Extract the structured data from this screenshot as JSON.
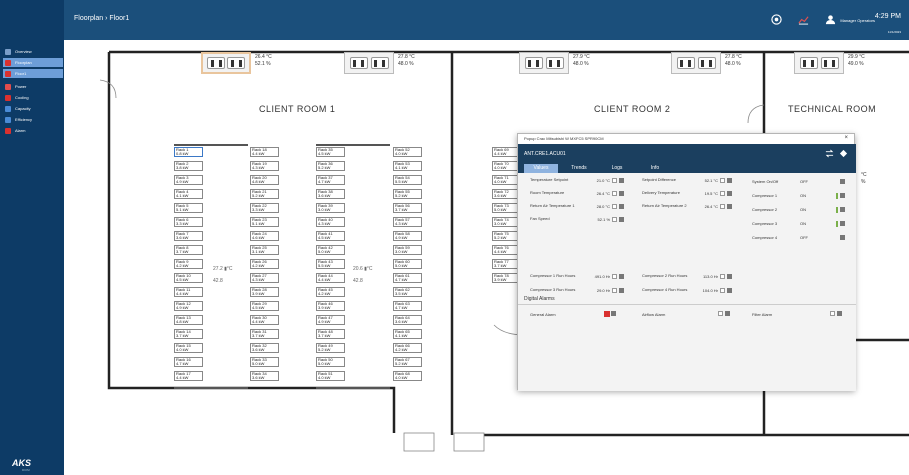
{
  "header": {
    "breadcrumb": "Floorplan  ›  Floor1",
    "time": "4:29 PM",
    "date": "11/1/2023",
    "user": "Manager Operators"
  },
  "nav": [
    {
      "label": "Overview",
      "color": "#7a9ec9"
    },
    {
      "label": "Floorplan",
      "color": "#d9312f"
    },
    {
      "label": "Floor1",
      "color": "#d9312f"
    },
    {
      "label": "Power",
      "color": "#e04d4d"
    },
    {
      "label": "Cooling",
      "color": "#d9312f"
    },
    {
      "label": "Capacity",
      "color": "#4a8bd6"
    },
    {
      "label": "Efficiency",
      "color": "#4a8bd6"
    },
    {
      "label": "Alarm",
      "color": "#d9312f"
    }
  ],
  "brand": {
    "name": "AKS",
    "sub": "DCIM"
  },
  "rooms": {
    "r1": "CLIENT ROOM 1",
    "r2": "CLIENT ROOM 2",
    "tech": "TECHNICAL ROOM"
  },
  "acus": [
    {
      "temp": "26.4 °C",
      "hum": "52.1 %"
    },
    {
      "temp": "27.8 °C",
      "hum": "48.0 %"
    },
    {
      "temp": "27.9 °C",
      "hum": "48.0 %"
    },
    {
      "temp": "27.8 °C",
      "hum": "48.0 %"
    },
    {
      "temp": "29.9 °C",
      "hum": "49.0 %"
    }
  ],
  "room_mid": [
    {
      "temp": "27.2",
      "unit": "°C",
      "pow": "42.8"
    },
    {
      "temp": "20.6",
      "unit": "°C",
      "pow": "42.8"
    }
  ],
  "col1": [
    [
      "Rack 1",
      "0.8 kW"
    ],
    [
      "Rack 2",
      "3.8 kW"
    ],
    [
      "Rack 3",
      "4.9 kW"
    ],
    [
      "Rack 4",
      "4.1 kW"
    ],
    [
      "Rack 5",
      "5.1 kW"
    ],
    [
      "Rack 6",
      "3.3 kW"
    ],
    [
      "Rack 7",
      "3.6 kW"
    ],
    [
      "Rack 8",
      "3.7 kW"
    ],
    [
      "Rack 9",
      "4.2 kW"
    ],
    [
      "Rack 10",
      "4.5 kW"
    ],
    [
      "Rack 11",
      "4.4 kW"
    ],
    [
      "Rack 12",
      "4.9 kW"
    ],
    [
      "Rack 13",
      "4.8 kW"
    ],
    [
      "Rack 14",
      "3.7 kW"
    ],
    [
      "Rack 15",
      "4.0 kW"
    ],
    [
      "Rack 16",
      "4.7 kW"
    ],
    [
      "Rack 17",
      "4.4 kW"
    ]
  ],
  "col2": [
    [
      "Rack 18",
      "4.4 kW"
    ],
    [
      "Rack 19",
      "4.3 kW"
    ],
    [
      "Rack 20",
      "4.8 kW"
    ],
    [
      "Rack 21",
      "5.2 kW"
    ],
    [
      "Rack 22",
      "3.3 kW"
    ],
    [
      "Rack 23",
      "5.1 kW"
    ],
    [
      "Rack 24",
      "4.6 kW"
    ],
    [
      "Rack 25",
      "3.1 kW"
    ],
    [
      "Rack 26",
      "4.2 kW"
    ],
    [
      "Rack 27",
      "4.3 kW"
    ],
    [
      "Rack 28",
      "3.9 kW"
    ],
    [
      "Rack 29",
      "4.5 kW"
    ],
    [
      "Rack 30",
      "4.4 kW"
    ],
    [
      "Rack 31",
      "3.7 kW"
    ],
    [
      "Rack 32",
      "3.6 kW"
    ],
    [
      "Rack 33",
      "5.0 kW"
    ],
    [
      "Rack 34",
      "3.6 kW"
    ]
  ],
  "col3": [
    [
      "Rack 35",
      "4.5 kW"
    ],
    [
      "Rack 36",
      "5.2 kW"
    ],
    [
      "Rack 37",
      "4.7 kW"
    ],
    [
      "Rack 38",
      "3.6 kW"
    ],
    [
      "Rack 39",
      "3.0 kW"
    ],
    [
      "Rack 40",
      "4.3 kW"
    ],
    [
      "Rack 41",
      "4.5 kW"
    ],
    [
      "Rack 42",
      "5.0 kW"
    ],
    [
      "Rack 43",
      "5.5 kW"
    ],
    [
      "Rack 44",
      "4.4 kW"
    ],
    [
      "Rack 45",
      "4.2 kW"
    ],
    [
      "Rack 46",
      "3.9 kW"
    ],
    [
      "Rack 47",
      "4.9 kW"
    ],
    [
      "Rack 48",
      "3.7 kW"
    ],
    [
      "Rack 49",
      "5.2 kW"
    ],
    [
      "Rack 50",
      "5.0 kW"
    ],
    [
      "Rack 51",
      "4.0 kW"
    ]
  ],
  "col4": [
    [
      "Rack 52",
      "4.0 kW"
    ],
    [
      "Rack 53",
      "4.1 kW"
    ],
    [
      "Rack 54",
      "5.5 kW"
    ],
    [
      "Rack 55",
      "5.2 kW"
    ],
    [
      "Rack 56",
      "3.7 kW"
    ],
    [
      "Rack 57",
      "4.3 kW"
    ],
    [
      "Rack 58",
      "4.9 kW"
    ],
    [
      "Rack 59",
      "3.0 kW"
    ],
    [
      "Rack 60",
      "5.0 kW"
    ],
    [
      "Rack 61",
      "4.7 kW"
    ],
    [
      "Rack 62",
      "3.5 kW"
    ],
    [
      "Rack 63",
      "4.7 kW"
    ],
    [
      "Rack 64",
      "3.6 kW"
    ],
    [
      "Rack 65",
      "4.1 kW"
    ],
    [
      "Rack 66",
      "4.2 kW"
    ],
    [
      "Rack 67",
      "5.2 kW"
    ],
    [
      "Rack 68",
      "4.0 kW"
    ]
  ],
  "col5": [
    [
      "Rack 69",
      "4.4 kW"
    ],
    [
      "Rack 70",
      "4.0 kW"
    ],
    [
      "Rack 71",
      "4.0 kW"
    ],
    [
      "Rack 72",
      "3.6 kW"
    ],
    [
      "Rack 73",
      "5.0 kW"
    ],
    [
      "Rack 74",
      "3.0 kW"
    ],
    [
      "Rack 75",
      "5.2 kW"
    ],
    [
      "Rack 76",
      "4.4 kW"
    ],
    [
      "Rack 77",
      "3.7 kW"
    ],
    [
      "Rack 78",
      "3.9 kW"
    ]
  ],
  "tech_side": {
    "unit": "°C",
    "pct": "%"
  },
  "dialog": {
    "title": "Popup Crac Mitsubishi W MXFC5 SPR90CM",
    "close": "×",
    "device": "ANT.CRE1.ACU01",
    "tabs": [
      "Values",
      "Trends",
      "Logs",
      "Info"
    ],
    "left": [
      {
        "label": "Temperature Setpoint",
        "value": "21.0 °C"
      },
      {
        "label": "Room Temperature",
        "value": "26.4 °C"
      },
      {
        "label": "Return Air Temperature 1",
        "value": "28.0 °C"
      },
      {
        "label": "Fan Speed",
        "value": "52.1 %"
      }
    ],
    "mid": [
      {
        "label": "Setpoint Difference",
        "value": "52.1 °C"
      },
      {
        "label": "Delivery Temperature",
        "value": "19.5 °C"
      },
      {
        "label": "Return Air Temperature 2",
        "value": "26.4 °C"
      }
    ],
    "right": [
      {
        "label": "System On/Off",
        "value": "OFF"
      },
      {
        "label": "Compressor 1",
        "value": "ON"
      },
      {
        "label": "Compressor 2",
        "value": "ON"
      },
      {
        "label": "Compressor 3",
        "value": "ON"
      },
      {
        "label": "Compressor 4",
        "value": "OFF"
      }
    ],
    "hours": [
      {
        "label": "Compressor 1 Run Hours",
        "value": "491.0 Hr"
      },
      {
        "label": "Compressor 3 Run Hours",
        "value": "29.0 Hr"
      },
      {
        "label": "Compressor 2 Run Hours",
        "value": "113.0 Hr"
      },
      {
        "label": "Compressor 4 Run Hours",
        "value": "104.0 Hr"
      }
    ],
    "digital": "Digital Alarms",
    "alarms": [
      "General Alarm",
      "Airflow Alarm",
      "Filter Alarm"
    ]
  }
}
